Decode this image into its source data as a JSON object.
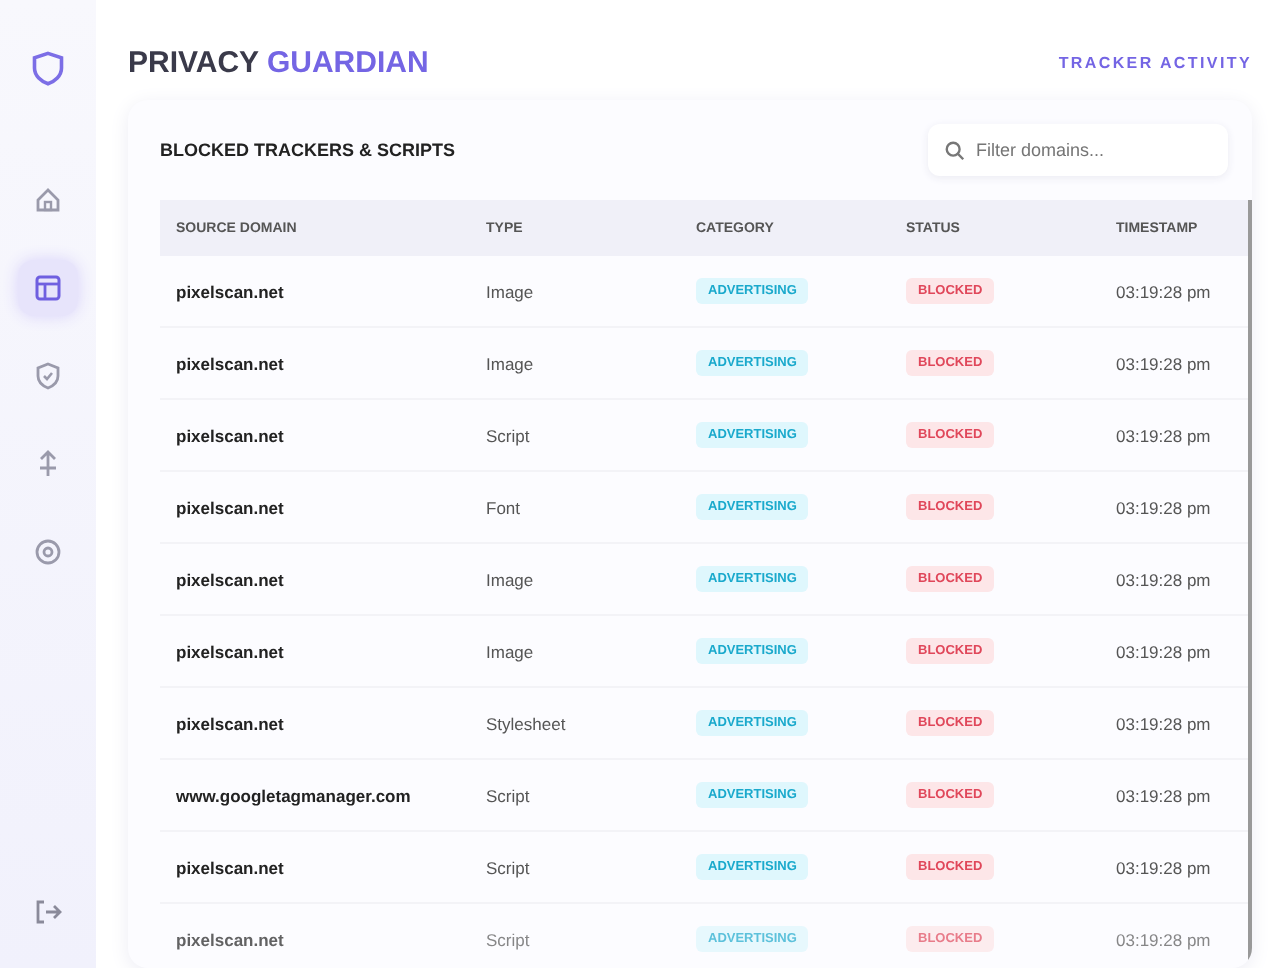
{
  "app": {
    "title_part1": "PRIVACY",
    "title_part2": "GUARDIAN",
    "header_link": "TRACKER ACTIVITY"
  },
  "sidebar": {
    "items": [
      {
        "kind": "home",
        "selected": false
      },
      {
        "kind": "panel",
        "selected": true
      },
      {
        "kind": "shield",
        "selected": false
      },
      {
        "kind": "upload",
        "selected": false
      },
      {
        "kind": "settings",
        "selected": false
      }
    ]
  },
  "card": {
    "title": "BLOCKED TRACKERS & SCRIPTS",
    "search": {
      "placeholder": "Filter domains..."
    }
  },
  "table": {
    "columns": [
      "SOURCE DOMAIN",
      "TYPE",
      "CATEGORY",
      "STATUS",
      "TIMESTAMP"
    ],
    "rows": [
      {
        "domain": "pixelscan.net",
        "type": "Image",
        "category": "ADVERTISING",
        "status": "BLOCKED",
        "time": "03:19:28 pm"
      },
      {
        "domain": "pixelscan.net",
        "type": "Image",
        "category": "ADVERTISING",
        "status": "BLOCKED",
        "time": "03:19:28 pm"
      },
      {
        "domain": "pixelscan.net",
        "type": "Script",
        "category": "ADVERTISING",
        "status": "BLOCKED",
        "time": "03:19:28 pm"
      },
      {
        "domain": "pixelscan.net",
        "type": "Font",
        "category": "ADVERTISING",
        "status": "BLOCKED",
        "time": "03:19:28 pm"
      },
      {
        "domain": "pixelscan.net",
        "type": "Image",
        "category": "ADVERTISING",
        "status": "BLOCKED",
        "time": "03:19:28 pm"
      },
      {
        "domain": "pixelscan.net",
        "type": "Image",
        "category": "ADVERTISING",
        "status": "BLOCKED",
        "time": "03:19:28 pm"
      },
      {
        "domain": "pixelscan.net",
        "type": "Stylesheet",
        "category": "ADVERTISING",
        "status": "BLOCKED",
        "time": "03:19:28 pm"
      },
      {
        "domain": "www.googletagmanager.com",
        "type": "Script",
        "category": "ADVERTISING",
        "status": "BLOCKED",
        "time": "03:19:28 pm"
      },
      {
        "domain": "pixelscan.net",
        "type": "Script",
        "category": "ADVERTISING",
        "status": "BLOCKED",
        "time": "03:19:28 pm"
      },
      {
        "domain": "pixelscan.net",
        "type": "Script",
        "category": "ADVERTISING",
        "status": "BLOCKED",
        "time": "03:19:28 pm"
      }
    ]
  }
}
